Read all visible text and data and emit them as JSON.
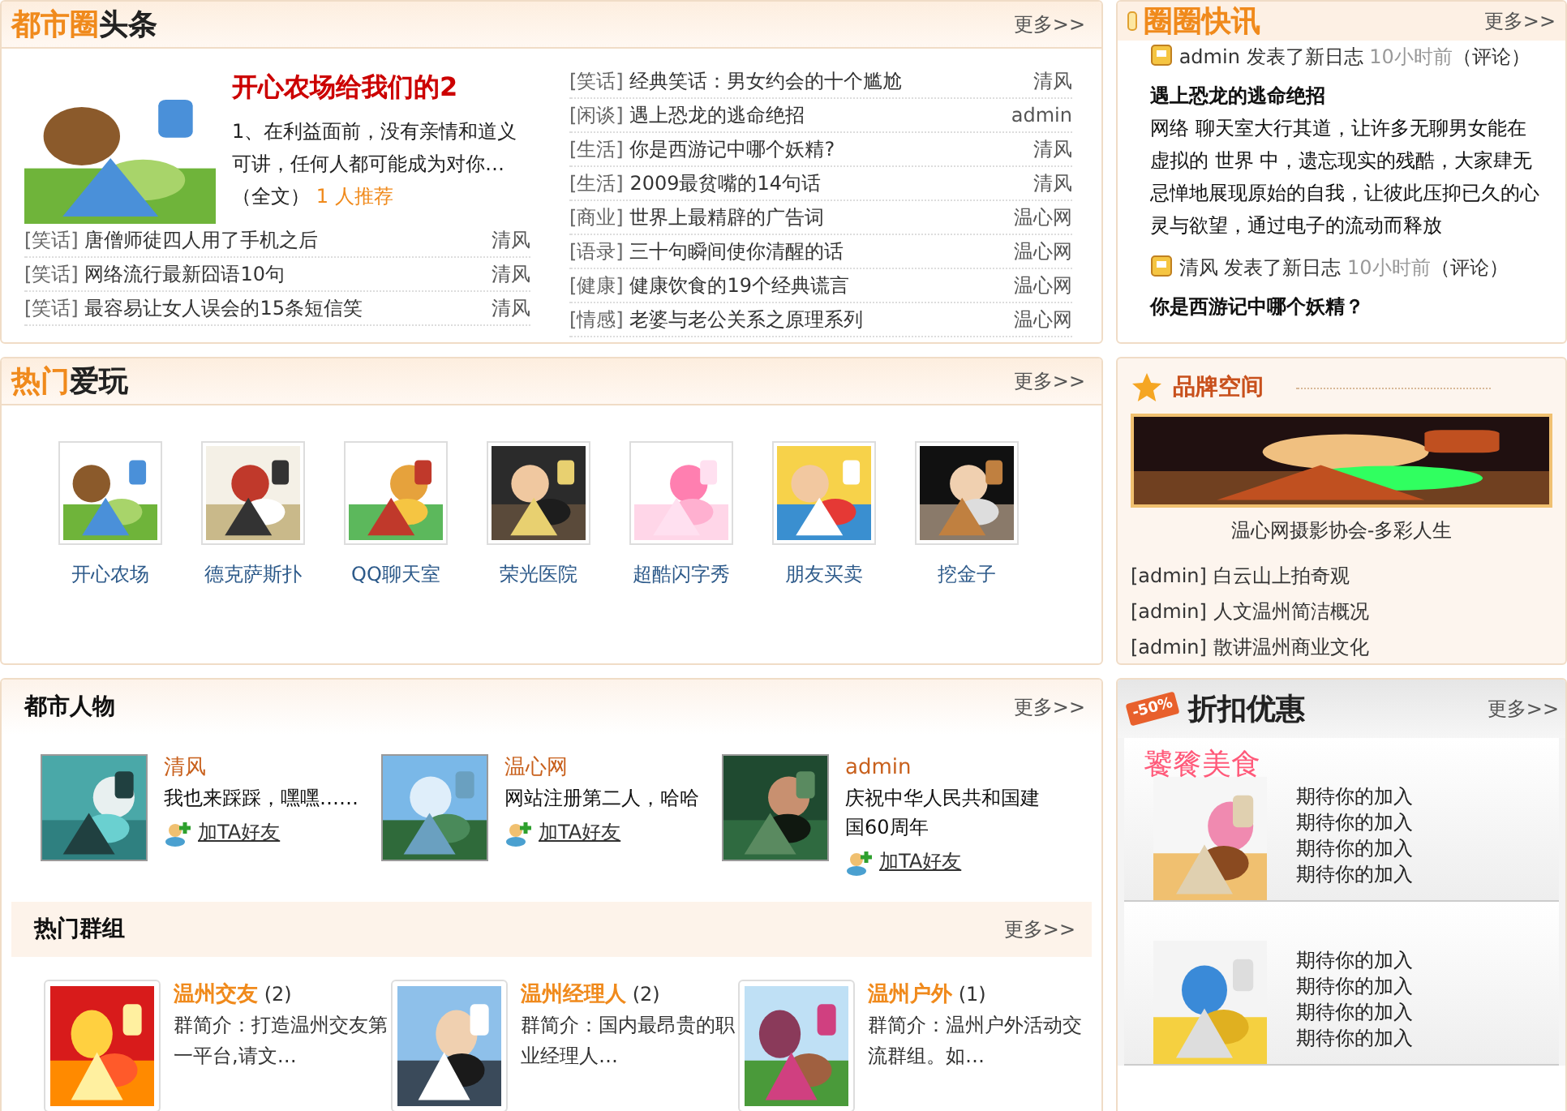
{
  "headlines": {
    "title_highlight": "都市圈",
    "title_rest": "头条",
    "more": "更多>>",
    "featured": {
      "title": "开心农场给我们的2",
      "summary": "1、在利益面前，没有亲情和道义可讲，任何人都可能成为对你…",
      "full_link": "（全文）",
      "recommend": "1 人推荐"
    },
    "left_items": [
      {
        "tag": "[笑话]",
        "title": "唐僧师徒四人用了手机之后",
        "author": "清风"
      },
      {
        "tag": "[笑话]",
        "title": "网络流行最新囧语10句",
        "author": "清风"
      },
      {
        "tag": "[笑话]",
        "title": "最容易让女人误会的15条短信笑",
        "author": "清风"
      }
    ],
    "right_items": [
      {
        "tag": "[笑话]",
        "title": "经典笑话：男女约会的十个尴尬",
        "author": "清风"
      },
      {
        "tag": "[闲谈]",
        "title": "遇上恐龙的逃命绝招",
        "author": "admin"
      },
      {
        "tag": "[生活]",
        "title": "你是西游记中哪个妖精?",
        "author": "清风"
      },
      {
        "tag": "[生活]",
        "title": "2009最贫嘴的14句话",
        "author": "清风"
      },
      {
        "tag": "[商业]",
        "title": "世界上最精辟的广告词",
        "author": "温心网"
      },
      {
        "tag": "[语录]",
        "title": "三十句瞬间使你清醒的话",
        "author": "温心网"
      },
      {
        "tag": "[健康]",
        "title": "健康饮食的19个经典谎言",
        "author": "温心网"
      },
      {
        "tag": "[情感]",
        "title": "老婆与老公关系之原理系列",
        "author": "温心网"
      }
    ]
  },
  "hot_play": {
    "title_highlight": "热门",
    "title_rest": "爱玩",
    "more": "更多>>",
    "apps": [
      {
        "label": "开心农场"
      },
      {
        "label": "德克萨斯扑"
      },
      {
        "label": "QQ聊天室"
      },
      {
        "label": "荣光医院"
      },
      {
        "label": "超酷闪字秀"
      },
      {
        "label": "朋友买卖"
      },
      {
        "label": "挖金子"
      }
    ]
  },
  "people": {
    "title": "都市人物",
    "more": "更多>>",
    "members": [
      {
        "name": "清风",
        "note": "我也来踩踩，嘿嘿……",
        "add_friend": "加TA好友"
      },
      {
        "name": "温心网",
        "note": "网站注册第二人，哈哈",
        "add_friend": "加TA好友"
      },
      {
        "name": "admin",
        "note": "庆祝中华人民共和国建国60周年",
        "add_friend": "加TA好友"
      }
    ]
  },
  "groups": {
    "title": "热门群组",
    "more": "更多>>",
    "items": [
      {
        "name": "温州交友",
        "count": "(2)",
        "intro": "群简介：打造温州交友第一平台,请文…"
      },
      {
        "name": "温州经理人",
        "count": "(2)",
        "intro": "群简介：国内最昂贵的职业经理人…"
      },
      {
        "name": "温州户外",
        "count": "(1)",
        "intro": "群简介：温州户外活动交流群组。如…"
      }
    ]
  },
  "quick_news": {
    "title": "圈圈快讯",
    "more": "更多>>",
    "entries": [
      {
        "user": "admin",
        "action": "发表了新日志",
        "time": "10小时前",
        "comment": "（评论）",
        "title": "遇上恐龙的逃命绝招",
        "body": "网络 聊天室大行其道，让许多无聊男女能在虚拟的 世界 中，遗忘现实的残酷，大家肆无忌惮地展现原始的自我，让彼此压抑已久的心灵与欲望，通过电子的流动而释放"
      },
      {
        "user": "清风",
        "action": "发表了新日志",
        "time": "10小时前",
        "comment": "（评论）",
        "title": "你是西游记中哪个妖精？"
      }
    ]
  },
  "brand_space": {
    "title": "品牌空间",
    "caption": "温心网摄影协会-多彩人生",
    "items": [
      {
        "author": "[admin]",
        "title": "白云山上拍奇观"
      },
      {
        "author": "[admin]",
        "title": "人文温州简洁概况"
      },
      {
        "author": "[admin]",
        "title": "散讲温州商业文化"
      }
    ]
  },
  "discount": {
    "badge": "-50%",
    "title": "折扣优惠",
    "more": "更多>>",
    "cards": [
      {
        "title": "饕餮美食",
        "lines": [
          "期待你的加入",
          "期待你的加入",
          "期待你的加入",
          "期待你的加入"
        ]
      },
      {
        "lines": [
          "期待你的加入",
          "期待你的加入",
          "期待你的加入",
          "期待你的加入"
        ]
      }
    ]
  }
}
